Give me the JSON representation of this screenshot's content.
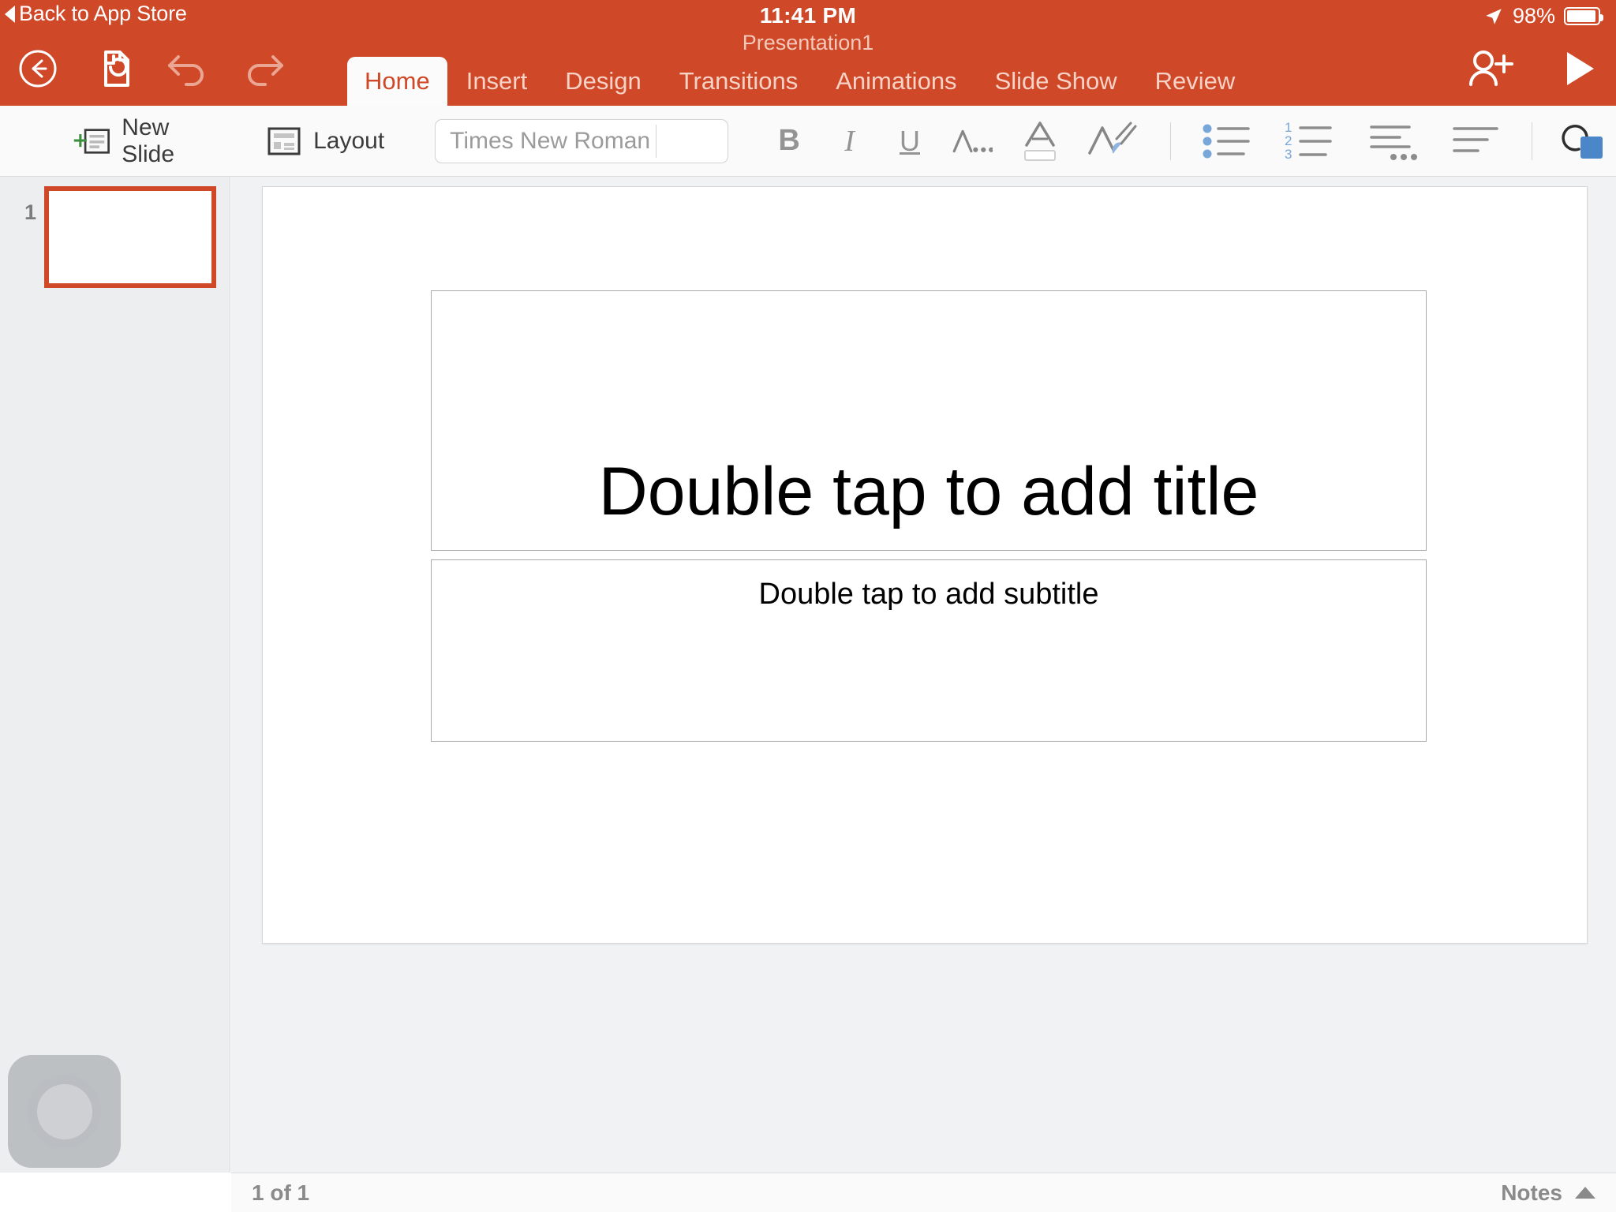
{
  "status_bar": {
    "back_label": "Back to App Store",
    "time": "11:41 PM",
    "document_name": "Presentation1",
    "battery_percent": "98%",
    "location_icon": "location-arrow-icon",
    "battery_icon": "battery-full-icon"
  },
  "header": {
    "accent_color": "#cf4827",
    "left_icons": [
      {
        "name": "back-button-icon",
        "label": "Back"
      },
      {
        "name": "file-sync-icon",
        "label": "File"
      },
      {
        "name": "undo-icon",
        "label": "Undo",
        "enabled": false
      },
      {
        "name": "redo-icon",
        "label": "Redo",
        "enabled": false
      }
    ],
    "right_icons": [
      {
        "name": "share-person-add-icon",
        "label": "Share"
      },
      {
        "name": "play-present-icon",
        "label": "Present"
      }
    ],
    "tabs": [
      {
        "label": "Home",
        "active": true
      },
      {
        "label": "Insert",
        "active": false
      },
      {
        "label": "Design",
        "active": false
      },
      {
        "label": "Transitions",
        "active": false
      },
      {
        "label": "Animations",
        "active": false
      },
      {
        "label": "Slide Show",
        "active": false
      },
      {
        "label": "Review",
        "active": false
      }
    ]
  },
  "toolbar": {
    "new_slide_label": "New Slide",
    "layout_label": "Layout",
    "font_name": "Times New Roman",
    "font_size": "",
    "bold_label": "B",
    "italic_label": "I",
    "underline_label": "U",
    "text_options_label": "A..",
    "font_color_label": "A",
    "highlight_label": "A",
    "font_color_swatch": "#ffffff",
    "highlight_swatch": "#8fb4dd",
    "list_accent_color": "#7aa7d9",
    "shape_swatch": "#4a86c8",
    "icons": [
      "new-slide-icon",
      "layout-icon",
      "bold-icon",
      "italic-icon",
      "underline-icon",
      "text-options-icon",
      "font-color-icon",
      "highlight-icon",
      "bullet-list-icon",
      "numbered-list-icon",
      "indent-icon",
      "align-left-icon",
      "shape-arrange-icon"
    ]
  },
  "slide_panel": {
    "slides": [
      {
        "number": "1",
        "selected": true
      }
    ]
  },
  "slide": {
    "title_placeholder": "Double tap to add title",
    "subtitle_placeholder": "Double tap to add subtitle"
  },
  "status_bottom": {
    "slide_counter": "1 of 1",
    "notes_label": "Notes",
    "notes_caret": "caret-up-icon"
  },
  "assistive_touch": {
    "name": "assistive-touch-button"
  }
}
